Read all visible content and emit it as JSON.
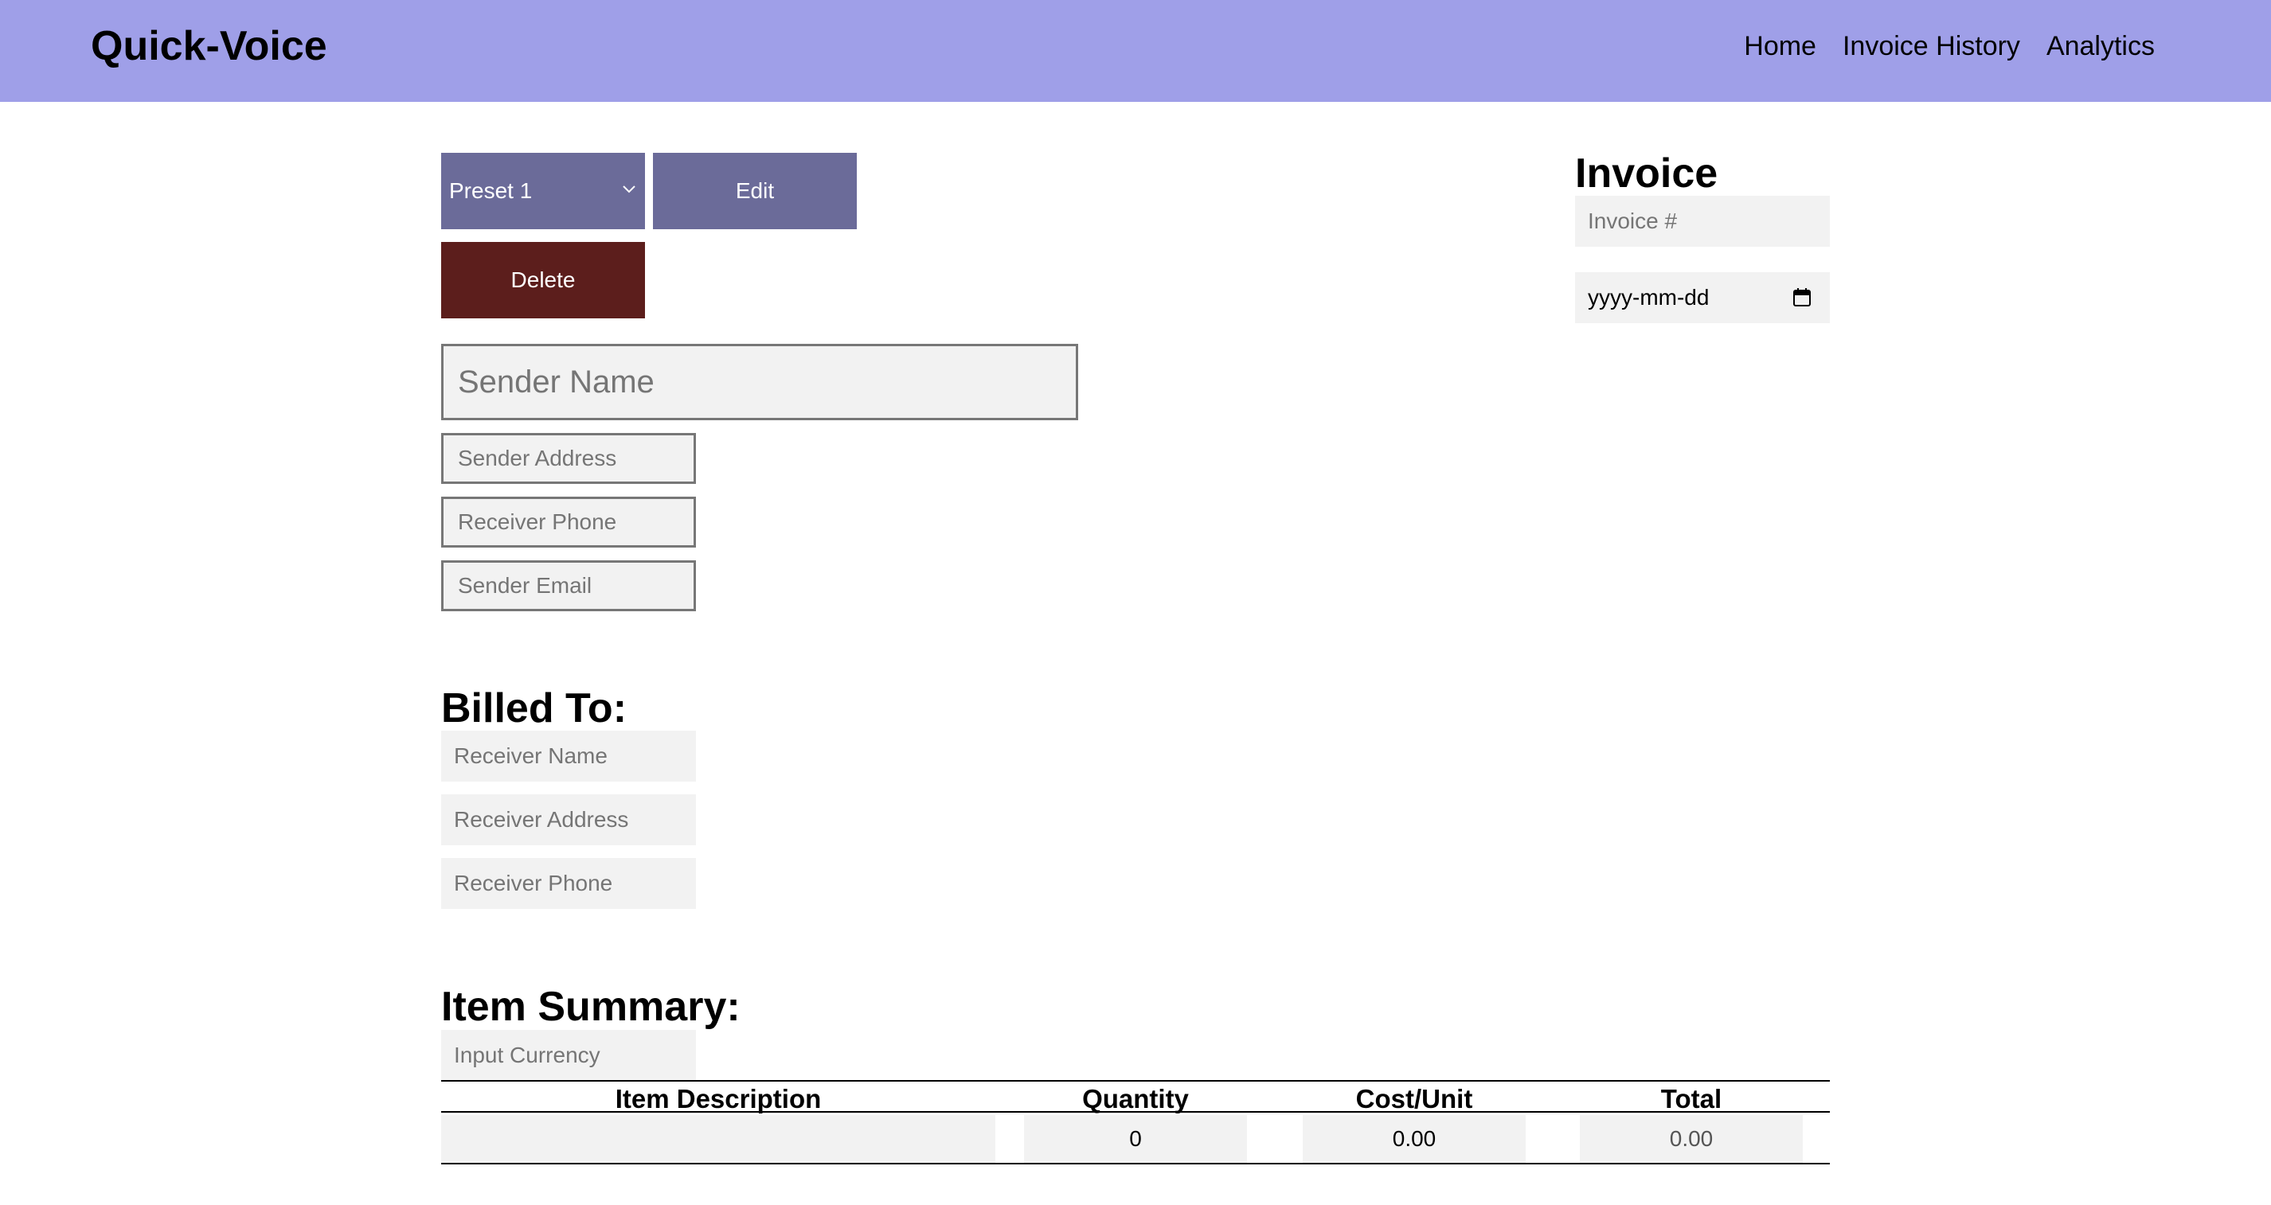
{
  "app": {
    "brand": "Quick-Voice"
  },
  "nav": {
    "items": [
      "Home",
      "Invoice History",
      "Analytics"
    ]
  },
  "toolbar": {
    "preset_selected": "Preset 1",
    "edit_label": "Edit",
    "delete_label": "Delete"
  },
  "sender": {
    "name_placeholder": "Sender Name",
    "address_placeholder": "Sender Address",
    "phone_placeholder": "Receiver Phone",
    "email_placeholder": "Sender Email"
  },
  "invoice": {
    "title": "Invoice",
    "number_placeholder": "Invoice #",
    "date_placeholder": "yyyy-mm-dd"
  },
  "billed_to": {
    "title": "Billed To:",
    "name_placeholder": "Receiver Name",
    "address_placeholder": "Receiver Address",
    "phone_placeholder": "Receiver Phone"
  },
  "item_summary": {
    "title": "Item Summary:",
    "currency_placeholder": "Input Currency",
    "columns": [
      "Item Description",
      "Quantity",
      "Cost/Unit",
      "Total"
    ],
    "rows": [
      {
        "description": "",
        "quantity": "0",
        "cost_unit": "0.00",
        "total": "0.00"
      }
    ]
  },
  "colors": {
    "header_bg": "#9f9fe8",
    "primary_button": "#6b6b99",
    "danger_button": "#5c1e1c",
    "input_bg": "#f2f2f2"
  }
}
